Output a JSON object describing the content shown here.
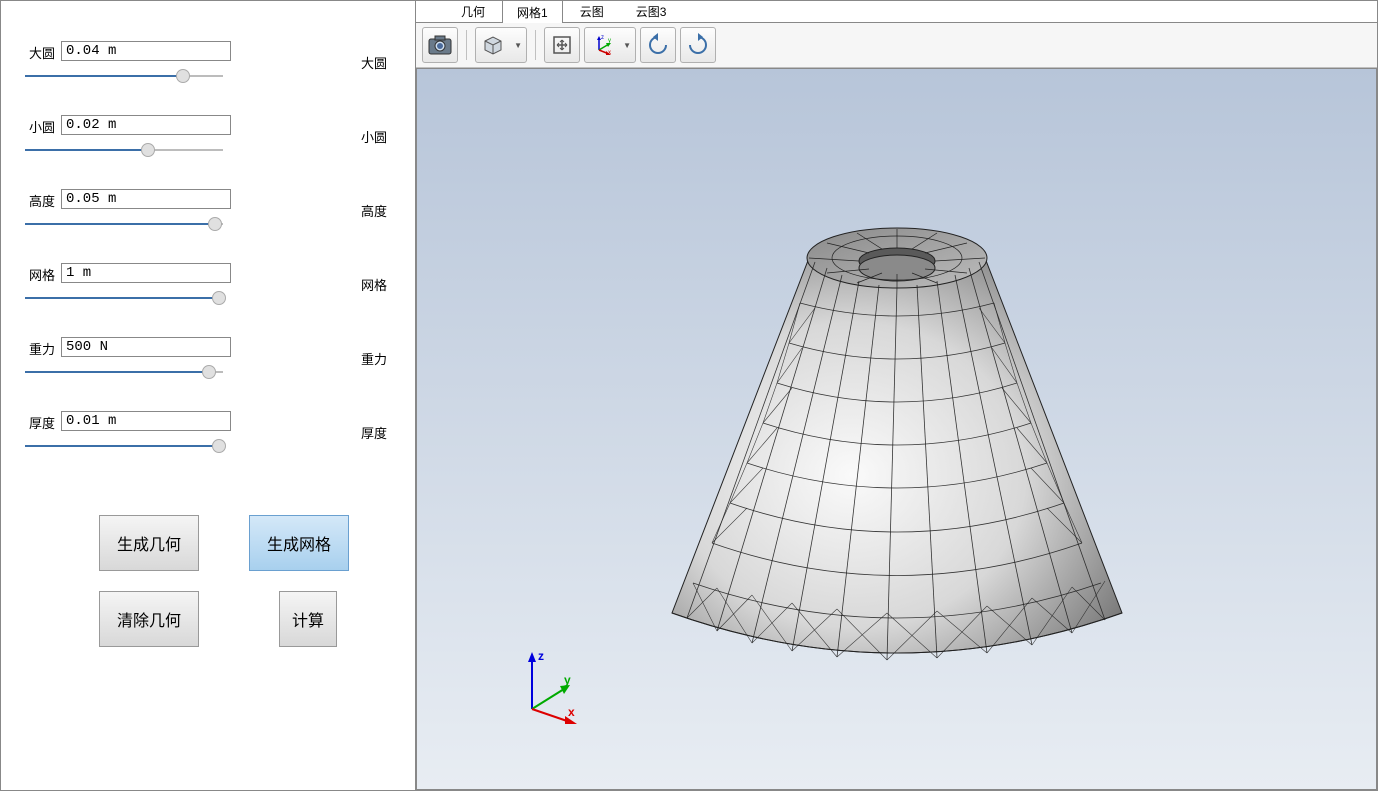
{
  "params": [
    {
      "left_label": "大圆",
      "value": "0.04 m",
      "right_label": "大圆",
      "slider_pct": 80
    },
    {
      "left_label": "小圆",
      "value": "0.02 m",
      "right_label": "小圆",
      "slider_pct": 62
    },
    {
      "left_label": "高度",
      "value": "0.05 m",
      "right_label": "高度",
      "slider_pct": 96
    },
    {
      "left_label": "网格",
      "value": "1 m",
      "right_label": "网格",
      "slider_pct": 98
    },
    {
      "left_label": "重力",
      "value": "500 N",
      "right_label": "重力",
      "slider_pct": 93
    },
    {
      "left_label": "厚度",
      "value": "0.01 m",
      "right_label": "厚度",
      "slider_pct": 98
    }
  ],
  "buttons": {
    "gen_geom": "生成几何",
    "gen_mesh": "生成网格",
    "clear_geom": "清除几何",
    "compute": "计算"
  },
  "tabs": [
    "几何",
    "网格1",
    "云图",
    "云图3"
  ],
  "active_tab": 1,
  "axis_labels": {
    "x": "x",
    "y": "y",
    "z": "z"
  }
}
